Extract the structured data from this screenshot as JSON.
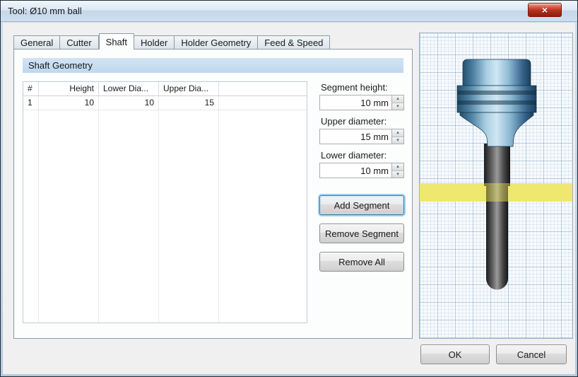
{
  "window": {
    "title": "Tool: Ø10 mm ball"
  },
  "icons": {
    "close": "×",
    "up": "▴",
    "down": "▾"
  },
  "tabs": [
    {
      "label": "General",
      "active": false
    },
    {
      "label": "Cutter",
      "active": false
    },
    {
      "label": "Shaft",
      "active": true
    },
    {
      "label": "Holder",
      "active": false
    },
    {
      "label": "Holder Geometry",
      "active": false
    },
    {
      "label": "Feed & Speed",
      "active": false
    }
  ],
  "shaft_tab": {
    "section_title": "Shaft Geometry",
    "table": {
      "columns": [
        "#",
        "Height",
        "Lower Dia...",
        "Upper Dia..."
      ],
      "rows": [
        {
          "num": "1",
          "height": "10",
          "lower": "10",
          "upper": "15"
        }
      ]
    },
    "fields": [
      {
        "label": "Segment height:",
        "value": "10 mm"
      },
      {
        "label": "Upper diameter:",
        "value": "15 mm"
      },
      {
        "label": "Lower diameter:",
        "value": "10 mm"
      }
    ],
    "buttons": [
      {
        "label": "Add Segment"
      },
      {
        "label": "Remove Segment"
      },
      {
        "label": "Remove All"
      }
    ]
  },
  "footer": {
    "ok": "OK",
    "cancel": "Cancel"
  },
  "colors": {
    "section_header_bg": "#c8dcf0",
    "stock_band_yellow": "#eee87d",
    "holder_blue": "#6fa7c8",
    "shaft_dark": "#4a4a4a",
    "focus_ring_blue": "#5cade0",
    "close_button_red": "#b3311e"
  }
}
